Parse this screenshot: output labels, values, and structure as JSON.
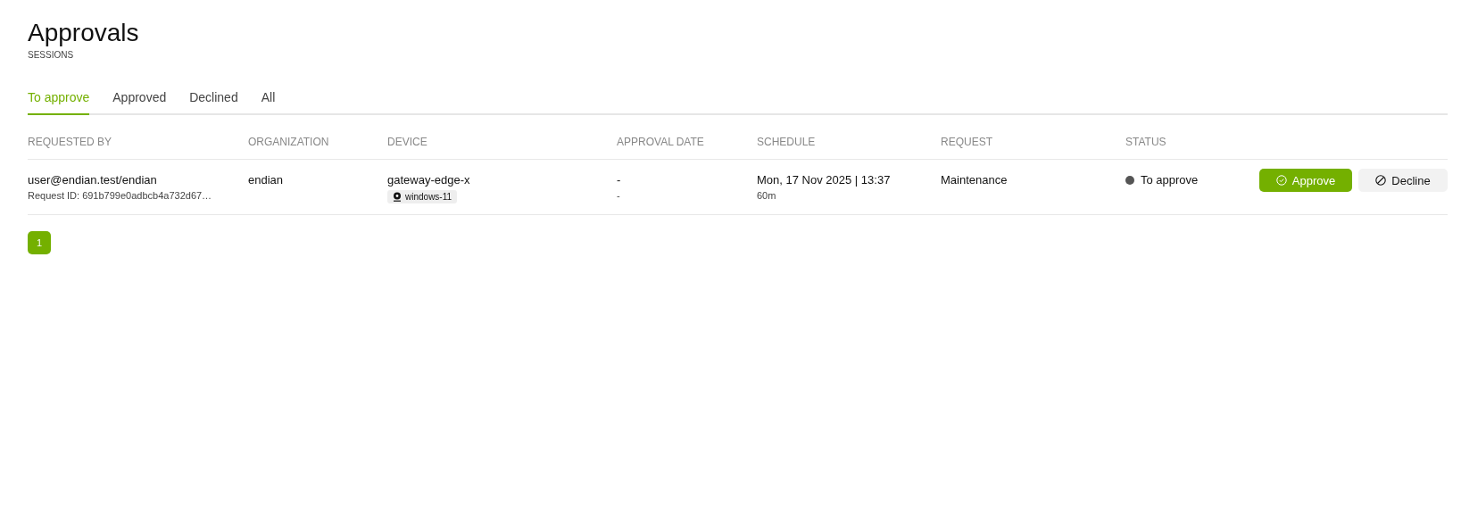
{
  "header": {
    "title": "Approvals",
    "subtitle": "SESSIONS"
  },
  "tabs": [
    {
      "label": "To approve",
      "selected": true
    },
    {
      "label": "Approved",
      "selected": false
    },
    {
      "label": "Declined",
      "selected": false
    },
    {
      "label": "All",
      "selected": false
    }
  ],
  "table": {
    "columns": [
      "REQUESTED BY",
      "ORGANIZATION",
      "DEVICE",
      "APPROVAL DATE",
      "SCHEDULE",
      "REQUEST",
      "STATUS"
    ],
    "rows": [
      {
        "requested_by": "user@endian.test/endian",
        "request_id": "Request ID: 691b799e0adbcb4a732d67…",
        "organization": "endian",
        "device": "gateway-edge-x",
        "device_tag": "windows-11",
        "approval_date": "-",
        "approval_sub": "-",
        "schedule": "Mon, 17 Nov 2025 | 13:37",
        "duration": "60m",
        "request": "Maintenance",
        "status": {
          "label": "To approve",
          "color": "#555555"
        },
        "actions": [
          {
            "kind": "approve",
            "label": "Approve"
          },
          {
            "kind": "decline",
            "label": "Decline"
          }
        ]
      }
    ]
  },
  "pagination": [
    {
      "label": "1",
      "selected": true
    }
  ]
}
